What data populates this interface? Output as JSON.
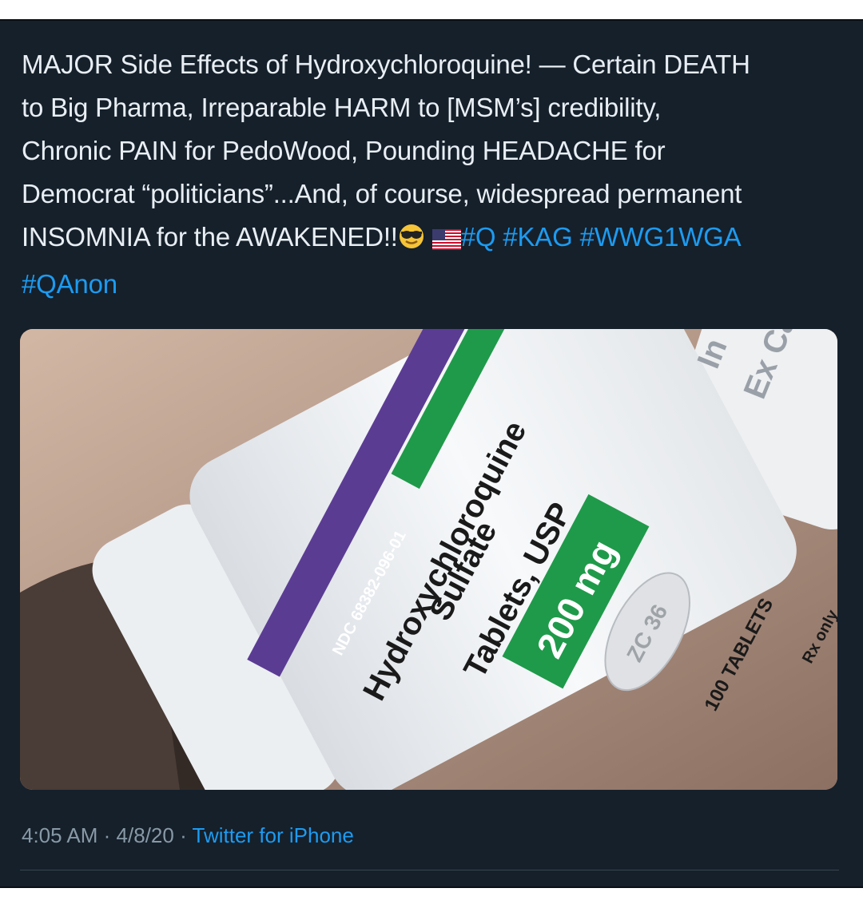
{
  "tweet": {
    "text_lines": [
      "MAJOR Side Effects of Hydroxychloroquine! — Certain DEATH",
      "to Big Pharma, Irreparable HARM to [MSM’s] credibility,",
      "Chronic PAIN for PedoWood, Pounding HEADACHE for",
      "Democrat “politicians”...And, of course, widespread permanent"
    ],
    "last_line_text": "INSOMNIA for the AWAKENED!!",
    "emoji_names": [
      "sunglasses-face-emoji",
      "us-flag-emoji"
    ],
    "hashtags": [
      "#Q",
      "#KAG",
      "#WWG1WGA",
      "#QAnon"
    ]
  },
  "media": {
    "description_icon": "pill-bottle-photo",
    "ndc": "NDC 68382-096-01",
    "drug_line1": "Hydroxychloroquine",
    "drug_line2": "Sulfate",
    "drug_line3": "Tablets, USP",
    "dose": "200 mg",
    "pill_imprint": "ZC 36",
    "count": "100 TABLETS",
    "rx": "Rx only",
    "side_label": "Ex Cap",
    "side_label_top": "In"
  },
  "footer": {
    "time": "4:05 AM",
    "separator": "·",
    "date": "4/8/20",
    "source": "Twitter for iPhone"
  },
  "colors": {
    "background": "#15202b",
    "text": "#e8eef3",
    "link": "#1d9bf0",
    "muted": "#8899a6",
    "label_purple": "#5b3c93",
    "label_green": "#1f9a4a"
  }
}
